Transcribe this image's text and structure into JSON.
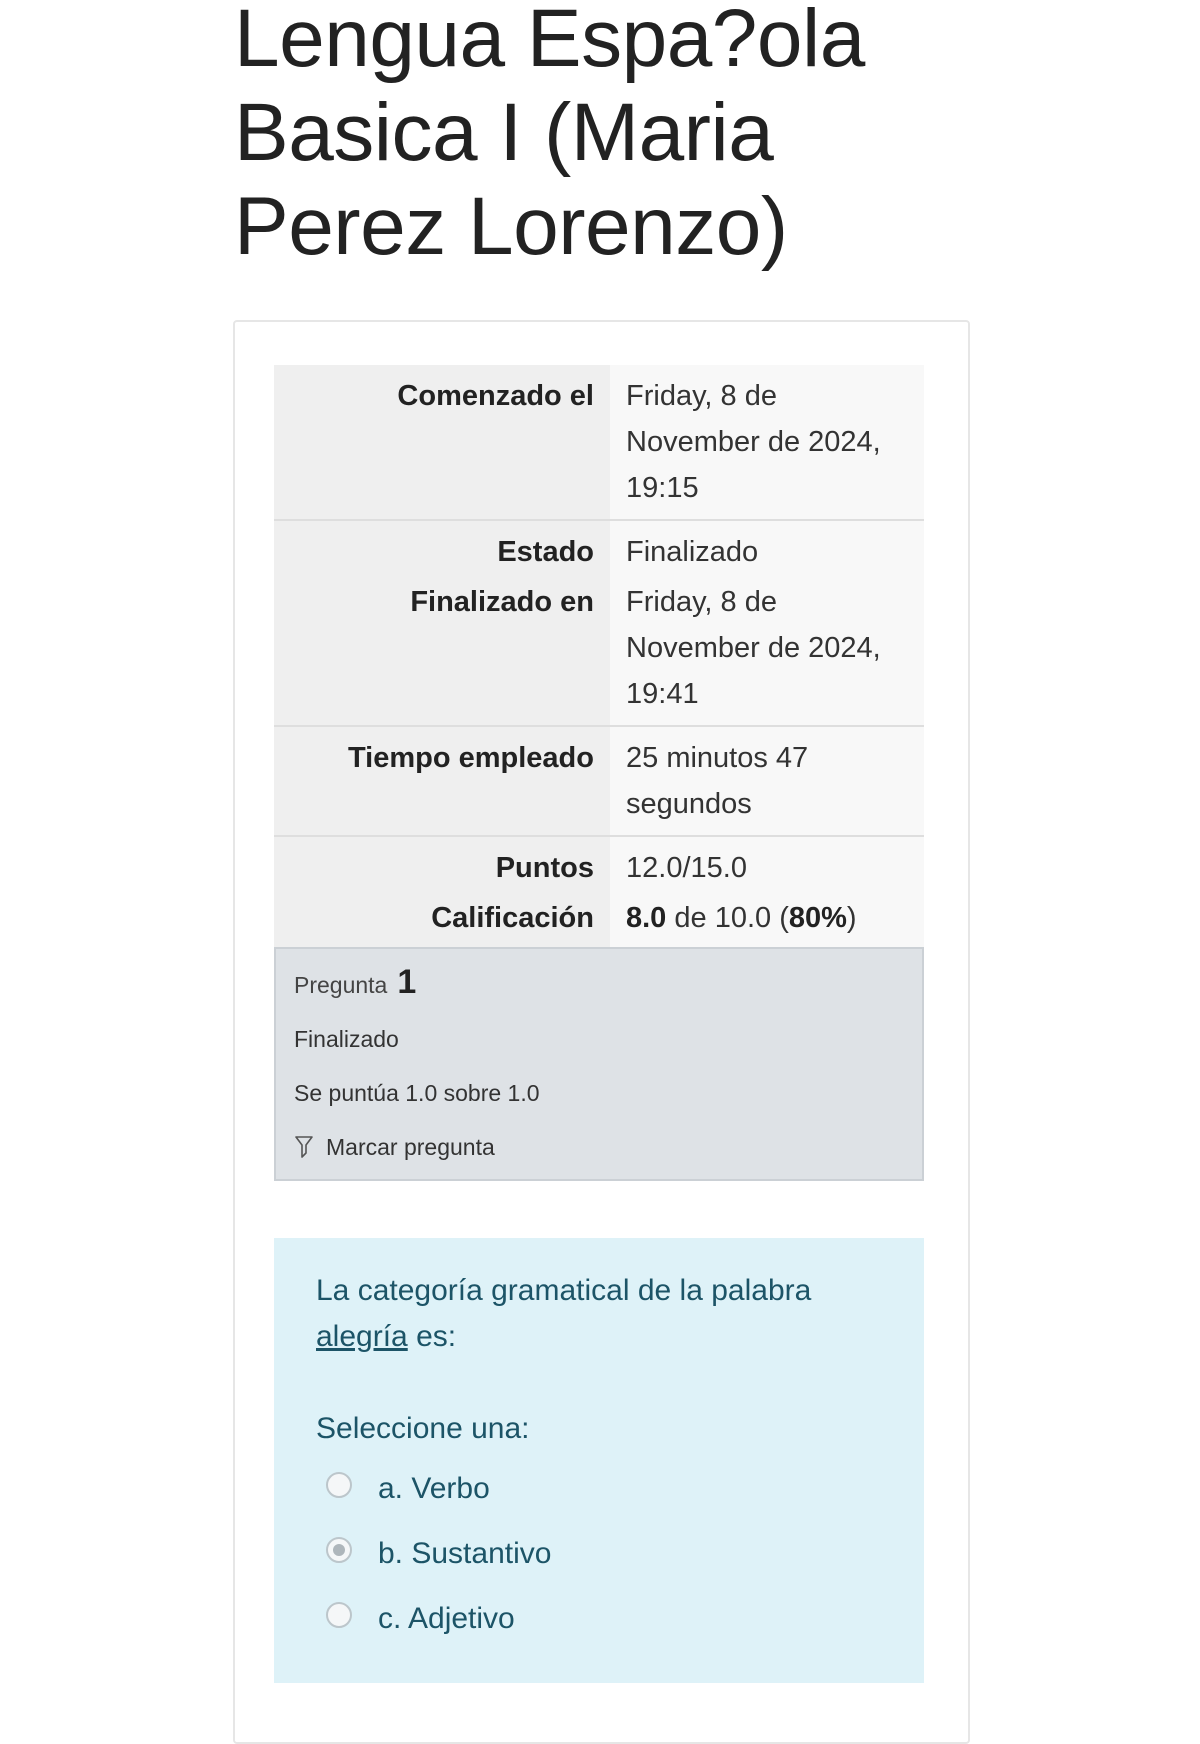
{
  "page": {
    "title": "Lengua Espa?ola Basica I (Maria Perez Lorenzo)"
  },
  "summary": {
    "started_label": "Comenzado el",
    "started_value": "Friday, 8 de November de 2024, 19:15",
    "state_label": "Estado",
    "state_value": "Finalizado",
    "finished_label": "Finalizado en",
    "finished_value": "Friday, 8 de November de 2024, 19:41",
    "time_label": "Tiempo empleado",
    "time_value": "25 minutos 47 segundos",
    "points_label": "Puntos",
    "points_value": "12.0/15.0",
    "grade_label": "Calificación",
    "grade_bold": "8.0",
    "grade_middle": " de 10.0 (",
    "grade_percent": "80%",
    "grade_end": ")"
  },
  "question_info": {
    "label": "Pregunta",
    "number": "1",
    "state": "Finalizado",
    "grade": "Se puntúa 1.0 sobre 1.0",
    "flag_label": "Marcar pregunta",
    "flag_icon": "flag-icon"
  },
  "question": {
    "prompt_before": "La categoría gramatical de la palabra ",
    "prompt_word": "alegría",
    "prompt_after": " es:",
    "select_label": "Seleccione una:",
    "answers": [
      {
        "label": "a. Verbo",
        "checked": false
      },
      {
        "label": "b. Sustantivo",
        "checked": true
      },
      {
        "label": "c. Adjetivo",
        "checked": false
      }
    ]
  },
  "colors": {
    "info_bg": "#dee2e6",
    "question_bg": "#def2f8",
    "question_text": "#1c5467"
  }
}
